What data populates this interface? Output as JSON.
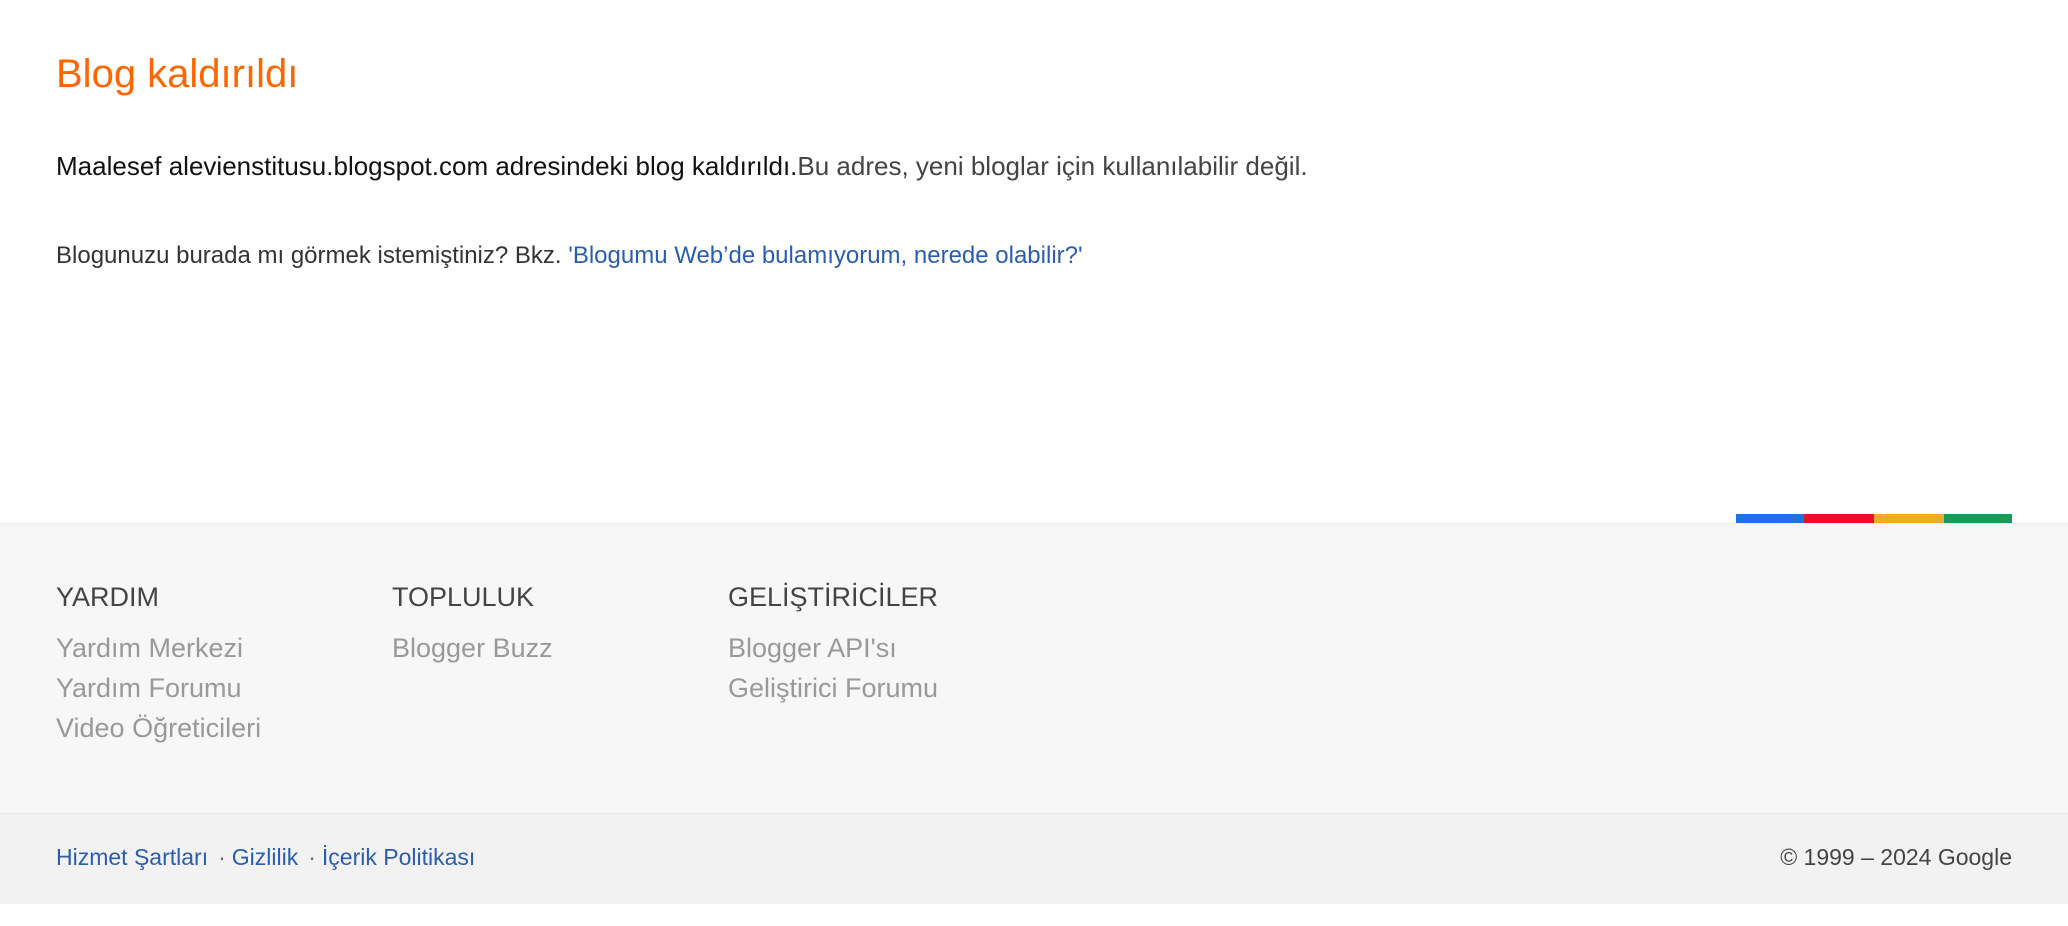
{
  "main": {
    "title": "Blog kaldırıldı",
    "message_part1": "Maalesef alevienstitusu.blogspot.com adresindeki blog kaldırıldı.",
    "message_part2": "Bu adres, yeni bloglar için kullanılabilir değil.",
    "help_prefix": "Blogunuzu burada mı görmek istemiştiniz? Bkz. ",
    "help_quote_open": "'",
    "help_link": "Blogumu Web’de bulamıyorum, nerede olabilir?",
    "help_quote_close": "'"
  },
  "colorbar": [
    "#1a73e8",
    "#ea0f2f",
    "#f9a825",
    "#0f9d58"
  ],
  "footer": {
    "columns": [
      {
        "heading": "YARDIM",
        "links": [
          "Yardım Merkezi",
          "Yardım Forumu",
          "Video Öğreticileri"
        ]
      },
      {
        "heading": "TOPLULUK",
        "links": [
          "Blogger Buzz"
        ]
      },
      {
        "heading": "GELİŞTİRİCİLER",
        "links": [
          "Blogger API'sı",
          "Geliştirici Forumu"
        ]
      }
    ],
    "legal": [
      "Hizmet Şartları",
      "Gizlilik",
      "İçerik Politikası"
    ],
    "separator": "·",
    "copyright": "© 1999 – 2024 Google"
  },
  "colors": {
    "title": "#ff6600",
    "link": "#2a5db0"
  }
}
